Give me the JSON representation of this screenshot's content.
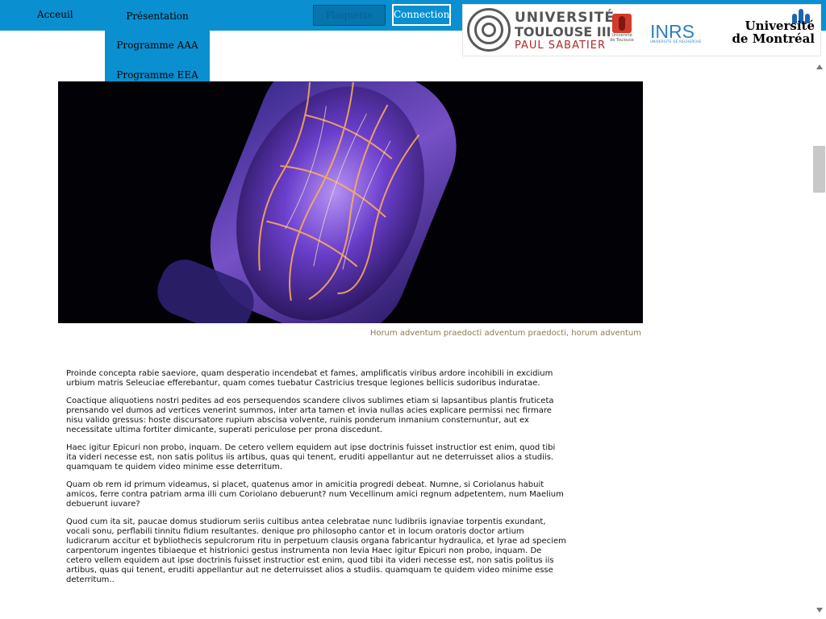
{
  "nav": {
    "home_label": "Acceuil",
    "presentation_label": "Présentation",
    "dropdown": [
      {
        "label": "Programme AAA"
      },
      {
        "label": "Programme EEA"
      }
    ],
    "plaquette_label": "Plaquette",
    "connection_label": "Connection"
  },
  "logos": {
    "ut": {
      "line1": "UNIVERSITÉ",
      "line2": "TOULOUSE III",
      "line3": "PAUL SABATIER",
      "mini1": "Université",
      "mini2": "de Toulouse"
    },
    "inrs": {
      "name": "INRS",
      "sub": "UNIVERSITÉ DE RECHERCHE"
    },
    "udem": {
      "line1": "Université",
      "line2": "de Montréal"
    }
  },
  "hero": {
    "image_alt": "hero-image"
  },
  "caption": "Horum adventum praedocti adventum praedocti, horum adventum",
  "article": {
    "paragraphs": [
      "Proinde concepta rabie saeviore, quam desperatio incendebat et fames, amplificatis viribus ardore incohibili in excidium urbium matris Seleuciae efferebantur, quam comes tuebatur Castricius tresque legiones bellicis sudoribus induratae.",
      "Coactique aliquotiens nostri pedites ad eos persequendos scandere clivos sublimes etiam si lapsantibus plantis fruticeta prensando vel dumos ad vertices venerint summos, inter arta tamen et invia nullas acies explicare permissi nec firmare nisu valido gressus: hoste discursatore rupium abscisa volvente, ruinis ponderum inmanium consternuntur, aut ex necessitate ultima fortiter dimicante, superati periculose per prona discedunt.",
      "Haec igitur Epicuri non probo, inquam. De cetero vellem equidem aut ipse doctrinis fuisset instructior est enim, quod tibi ita videri necesse est, non satis politus iis artibus, quas qui tenent, eruditi appellantur aut ne deterruisset alios a studiis. quamquam te quidem video minime esse deterritum.",
      "Quam ob rem id primum videamus, si placet, quatenus amor in amicitia progredi debeat. Numne, si Coriolanus habuit amicos, ferre contra patriam arma illi cum Coriolano debuerunt? num Vecellinum amici regnum adpetentem, num Maelium debuerunt iuvare?",
      "Quod cum ita sit, paucae domus studiorum seriis cultibus antea celebratae nunc ludibriis ignaviae torpentis exundant, vocali sonu, perflabili tinnitu fidium resultantes. denique pro philosopho cantor et in locum oratoris doctor artium ludicrarum accitur et bybliothecis sepulcrorum ritu in perpetuum clausis organa fabricantur hydraulica, et lyrae ad speciem carpentorum ingentes tibiaeque et histrionici gestus instrumenta non levia Haec igitur Epicuri non probo, inquam. De cetero vellem equidem aut ipse doctrinis fuisset instructior est enim, quod tibi ita videri necesse est, non satis politus iis artibus, quas qui tenent, eruditi appellantur aut ne deterruisset alios a studiis. quamquam te quidem video minime esse deterritum.."
    ]
  },
  "colors": {
    "nav_blue": "#0a90d0",
    "caption": "#8a7a54"
  }
}
